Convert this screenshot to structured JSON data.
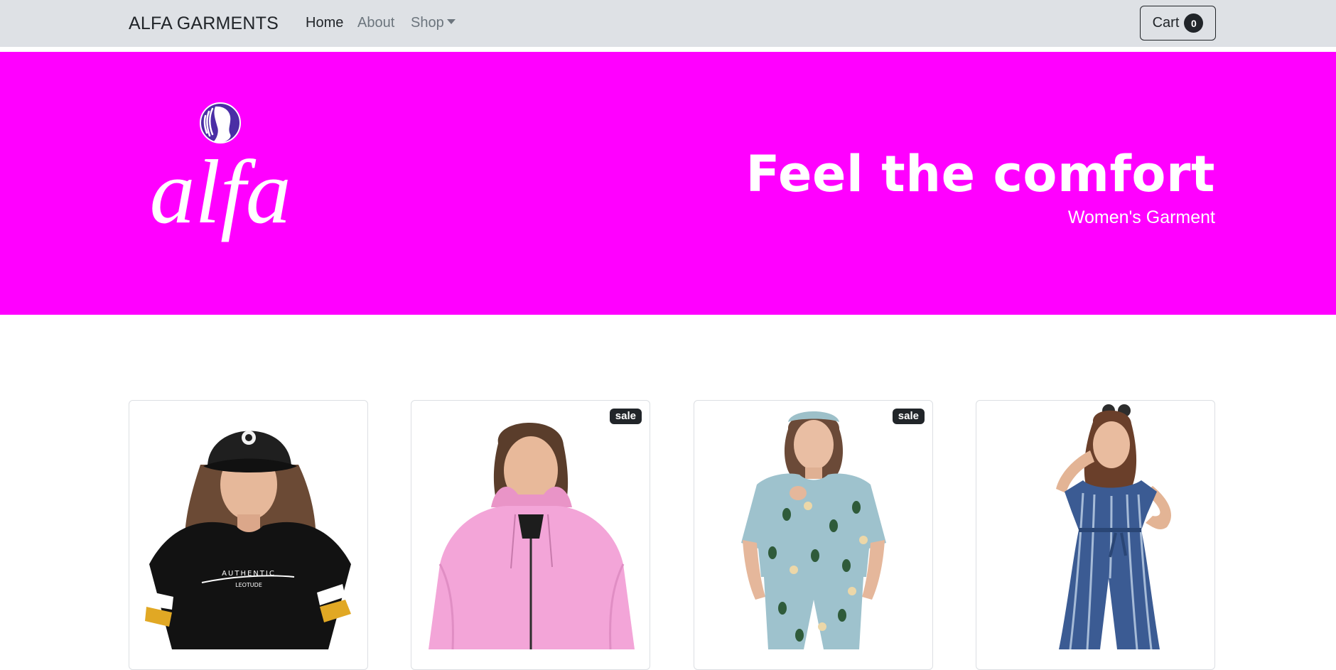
{
  "navbar": {
    "brand": "ALFA GARMENTS",
    "links": [
      {
        "label": "Home",
        "active": true
      },
      {
        "label": "About",
        "active": false
      },
      {
        "label": "Shop",
        "active": false,
        "dropdown": true
      }
    ],
    "cart": {
      "label": "Cart",
      "count": "0"
    },
    "background": "#dee1e5"
  },
  "hero": {
    "logo_text": "alfa",
    "title": "Feel the comfort",
    "subtitle": "Women's Garment",
    "background": "#ff00ff"
  },
  "products": [
    {
      "sale": false,
      "badge": "",
      "image": "woman in black cap and black oversized tee"
    },
    {
      "sale": true,
      "badge": "sale",
      "image": "woman in pink zip hoodie"
    },
    {
      "sale": true,
      "badge": "sale",
      "image": "woman in light blue avocado print pajama set"
    },
    {
      "sale": false,
      "badge": "",
      "image": "woman in blue tie-dye jumpsuit"
    }
  ],
  "colors": {
    "accent": "#ff00ff",
    "dark": "#212529",
    "muted": "#6c757d"
  }
}
